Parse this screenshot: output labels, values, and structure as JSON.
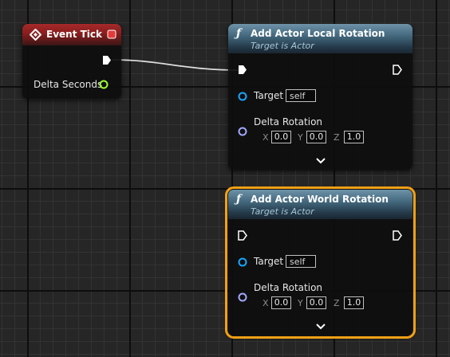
{
  "colors": {
    "graph_bg": "#262626",
    "event_header": "#a52a2a",
    "function_header": "#44697e",
    "selection": "#f2a016",
    "object_pin": "#1aa6ff",
    "rotator_pin": "#a3a8ff",
    "float_pin": "#9cff2e",
    "exec_pin": "#ffffff"
  },
  "event_tick": {
    "title": "Event Tick",
    "icon": "event-diamond-icon",
    "delta_seconds_label": "Delta Seconds"
  },
  "local_rotation": {
    "title": "Add Actor Local Rotation",
    "subtitle": "Target is Actor",
    "icon": "function-icon",
    "target_label": "Target",
    "target_value": "self",
    "delta_label": "Delta Rotation",
    "x_label": "X",
    "x_value": "0.0",
    "y_label": "Y",
    "y_value": "0.0",
    "z_label": "Z",
    "z_value": "1.0"
  },
  "world_rotation": {
    "title": "Add Actor World Rotation",
    "subtitle": "Target is Actor",
    "icon": "function-icon",
    "selected": true,
    "target_label": "Target",
    "target_value": "self",
    "delta_label": "Delta Rotation",
    "x_label": "X",
    "x_value": "0.0",
    "y_label": "Y",
    "y_value": "0.0",
    "z_label": "Z",
    "z_value": "1.0"
  },
  "glyphs": {
    "function": "ƒ"
  }
}
